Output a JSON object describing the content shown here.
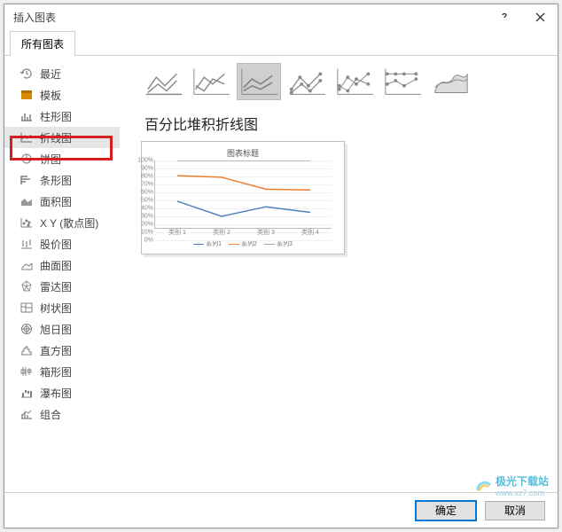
{
  "dialog": {
    "title": "插入图表"
  },
  "tabs": {
    "all_charts": "所有图表"
  },
  "categories": [
    {
      "key": "recent",
      "label": "最近",
      "icon": "recent"
    },
    {
      "key": "template",
      "label": "模板",
      "icon": "template"
    },
    {
      "key": "column",
      "label": "柱形图",
      "icon": "column"
    },
    {
      "key": "line",
      "label": "折线图",
      "icon": "line",
      "selected": true,
      "highlighted": true
    },
    {
      "key": "pie",
      "label": "饼图",
      "icon": "pie"
    },
    {
      "key": "bar",
      "label": "条形图",
      "icon": "bar"
    },
    {
      "key": "area",
      "label": "面积图",
      "icon": "area"
    },
    {
      "key": "xy",
      "label": "X Y (散点图)",
      "icon": "scatter"
    },
    {
      "key": "stock",
      "label": "股价图",
      "icon": "stock"
    },
    {
      "key": "surface",
      "label": "曲面图",
      "icon": "surface"
    },
    {
      "key": "radar",
      "label": "雷达图",
      "icon": "radar"
    },
    {
      "key": "treemap",
      "label": "树状图",
      "icon": "treemap"
    },
    {
      "key": "sunburst",
      "label": "旭日图",
      "icon": "sunburst"
    },
    {
      "key": "histogram",
      "label": "直方图",
      "icon": "histogram"
    },
    {
      "key": "boxwhisker",
      "label": "箱形图",
      "icon": "boxwhisker"
    },
    {
      "key": "waterfall",
      "label": "瀑布图",
      "icon": "waterfall"
    },
    {
      "key": "combo",
      "label": "组合",
      "icon": "combo"
    }
  ],
  "selected_chart_type": {
    "name": "百分比堆积折线图"
  },
  "subtypes_count": 7,
  "selected_subtype_index": 2,
  "preview": {
    "title": "图表标题",
    "y_ticks": [
      "100%",
      "90%",
      "80%",
      "70%",
      "60%",
      "50%",
      "40%",
      "30%",
      "20%",
      "10%",
      "0%"
    ],
    "x_ticks": [
      "类别 1",
      "类别 2",
      "类别 3",
      "类别 4"
    ],
    "legend": [
      "系列1",
      "系列2",
      "系列3"
    ]
  },
  "chart_data": {
    "type": "line",
    "title": "图表标题",
    "xlabel": "",
    "ylabel": "",
    "ylim": [
      0,
      100
    ],
    "categories": [
      "类别 1",
      "类别 2",
      "类别 3",
      "类别 4"
    ],
    "series": [
      {
        "name": "系列1",
        "color": "#4f81bd",
        "values": [
          49,
          30,
          42,
          35
        ]
      },
      {
        "name": "系列2",
        "color": "#ed7d31",
        "values": [
          81,
          79,
          64,
          63
        ]
      },
      {
        "name": "系列3",
        "color": "#a5a5a5",
        "values": [
          100,
          100,
          100,
          100
        ]
      }
    ]
  },
  "buttons": {
    "ok": "确定",
    "cancel": "取消"
  },
  "watermark": {
    "name": "极光下载站",
    "url": "www.xz7.com"
  }
}
